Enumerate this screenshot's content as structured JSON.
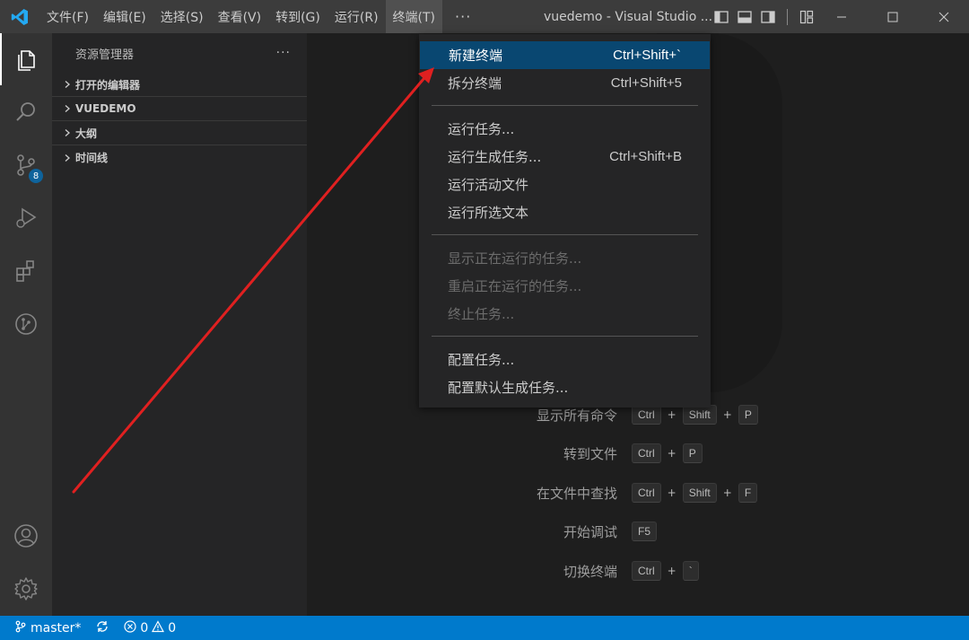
{
  "titlebar": {
    "menu": [
      "文件(F)",
      "编辑(E)",
      "选择(S)",
      "查看(V)",
      "转到(G)",
      "运行(R)",
      "终端(T)"
    ],
    "more": "···",
    "window_title": "vuedemo - Visual Studio ..."
  },
  "activity": {
    "scm_badge": "8"
  },
  "sidebar": {
    "title": "资源管理器",
    "more": "···",
    "sections": [
      "打开的编辑器",
      "VUEDEMO",
      "大纲",
      "时间线"
    ]
  },
  "menu_dropdown": {
    "items": [
      {
        "label": "新建终端",
        "shortcut": "Ctrl+Shift+`"
      },
      {
        "label": "拆分终端",
        "shortcut": "Ctrl+Shift+5"
      },
      {
        "label": "运行任务...",
        "shortcut": ""
      },
      {
        "label": "运行生成任务...",
        "shortcut": "Ctrl+Shift+B"
      },
      {
        "label": "运行活动文件",
        "shortcut": ""
      },
      {
        "label": "运行所选文本",
        "shortcut": ""
      },
      {
        "label": "显示正在运行的任务...",
        "shortcut": ""
      },
      {
        "label": "重启正在运行的任务...",
        "shortcut": ""
      },
      {
        "label": "终止任务...",
        "shortcut": ""
      },
      {
        "label": "配置任务...",
        "shortcut": ""
      },
      {
        "label": "配置默认生成任务...",
        "shortcut": ""
      }
    ]
  },
  "editor": {
    "shortcuts": [
      {
        "label": "显示所有命令",
        "keys": [
          "Ctrl",
          "Shift",
          "P"
        ]
      },
      {
        "label": "转到文件",
        "keys": [
          "Ctrl",
          "P"
        ]
      },
      {
        "label": "在文件中查找",
        "keys": [
          "Ctrl",
          "Shift",
          "F"
        ]
      },
      {
        "label": "开始调试",
        "keys": [
          "F5"
        ]
      },
      {
        "label": "切换终端",
        "keys": [
          "Ctrl",
          "`"
        ]
      }
    ],
    "plus": "+"
  },
  "statusbar": {
    "branch": "master*",
    "errors": "0",
    "warnings": "0"
  },
  "colors": {
    "accent": "#007acc",
    "menu_highlight": "#094771",
    "arrow": "#e02020"
  }
}
